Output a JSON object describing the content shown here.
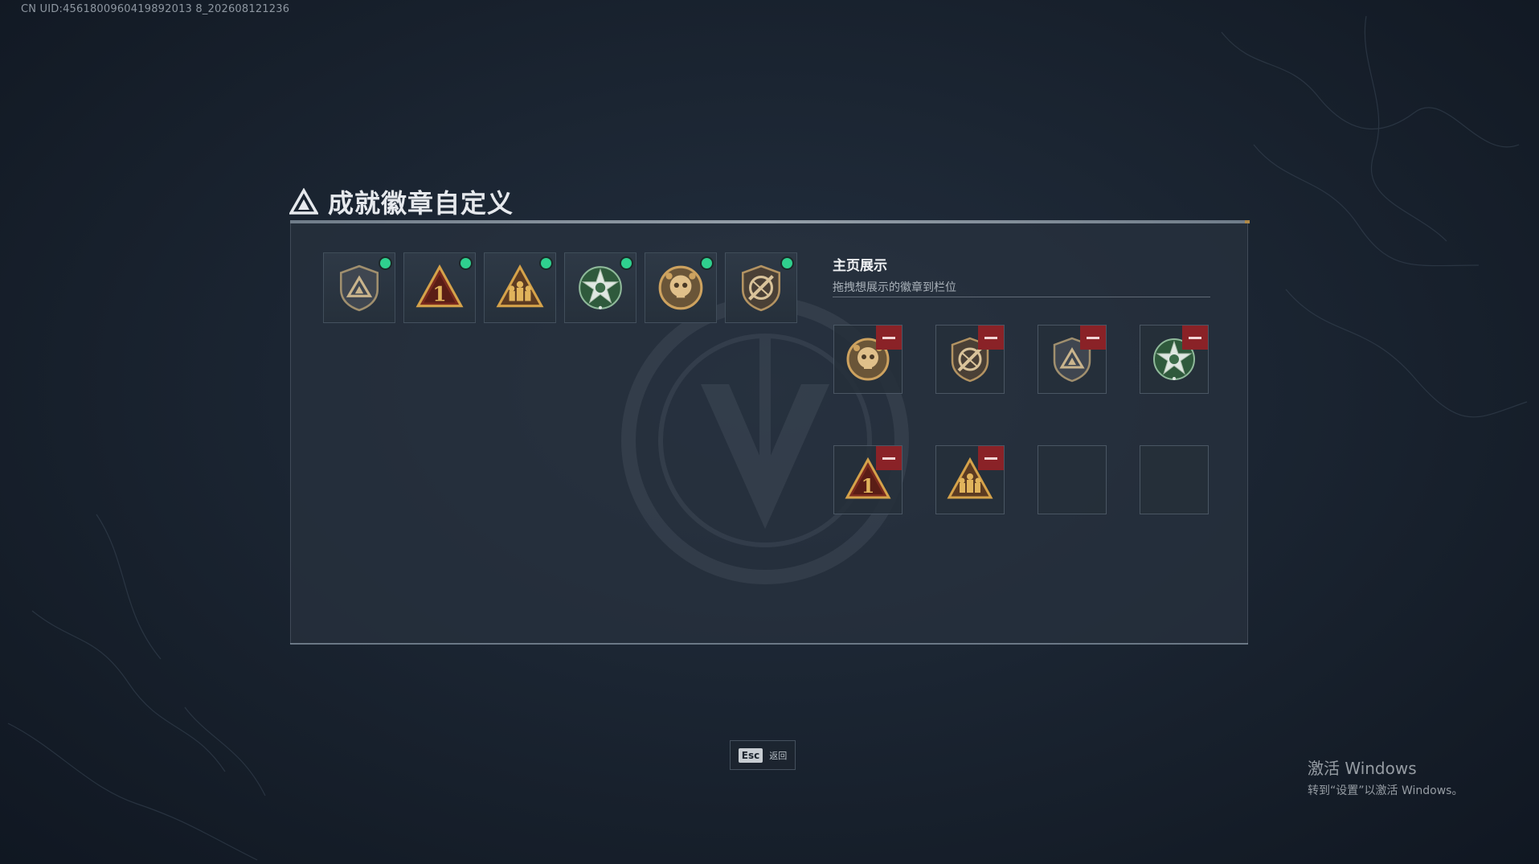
{
  "uid_text": "CN UID:4561800960419892013 8_202608121236",
  "title": "成就徽章自定义",
  "inventory": {
    "badges": [
      {
        "icon": "shield-triangle-badge-icon",
        "new": true
      },
      {
        "icon": "rank-one-triangle-badge-icon",
        "new": true
      },
      {
        "icon": "squad-triangle-badge-icon",
        "new": true
      },
      {
        "icon": "green-star-wreath-badge-icon",
        "new": true
      },
      {
        "icon": "gold-skull-medal-badge-icon",
        "new": true
      },
      {
        "icon": "crossed-rifle-shield-badge-icon",
        "new": true
      }
    ]
  },
  "showcase": {
    "title": "主页展示",
    "subtitle": "拖拽想展示的徽章到栏位",
    "slots": [
      {
        "icon": "gold-skull-medal-badge-icon",
        "filled": true
      },
      {
        "icon": "crossed-rifle-shield-badge-icon",
        "filled": true
      },
      {
        "icon": "shield-triangle-badge-icon",
        "filled": true
      },
      {
        "icon": "green-star-wreath-badge-icon",
        "filled": true
      },
      {
        "icon": "rank-one-triangle-badge-icon",
        "filled": true
      },
      {
        "icon": "squad-triangle-badge-icon",
        "filled": true
      },
      {
        "icon": "",
        "filled": false
      },
      {
        "icon": "",
        "filled": false
      }
    ]
  },
  "footer": {
    "key": "Esc",
    "label": "返回"
  },
  "watermark": {
    "title": "激活 Windows",
    "subtitle": "转到“设置”以激活 Windows。"
  },
  "colors": {
    "new_dot": "#2fd08e",
    "remove_button": "#8a2227",
    "panel_bg": "#28323e"
  }
}
